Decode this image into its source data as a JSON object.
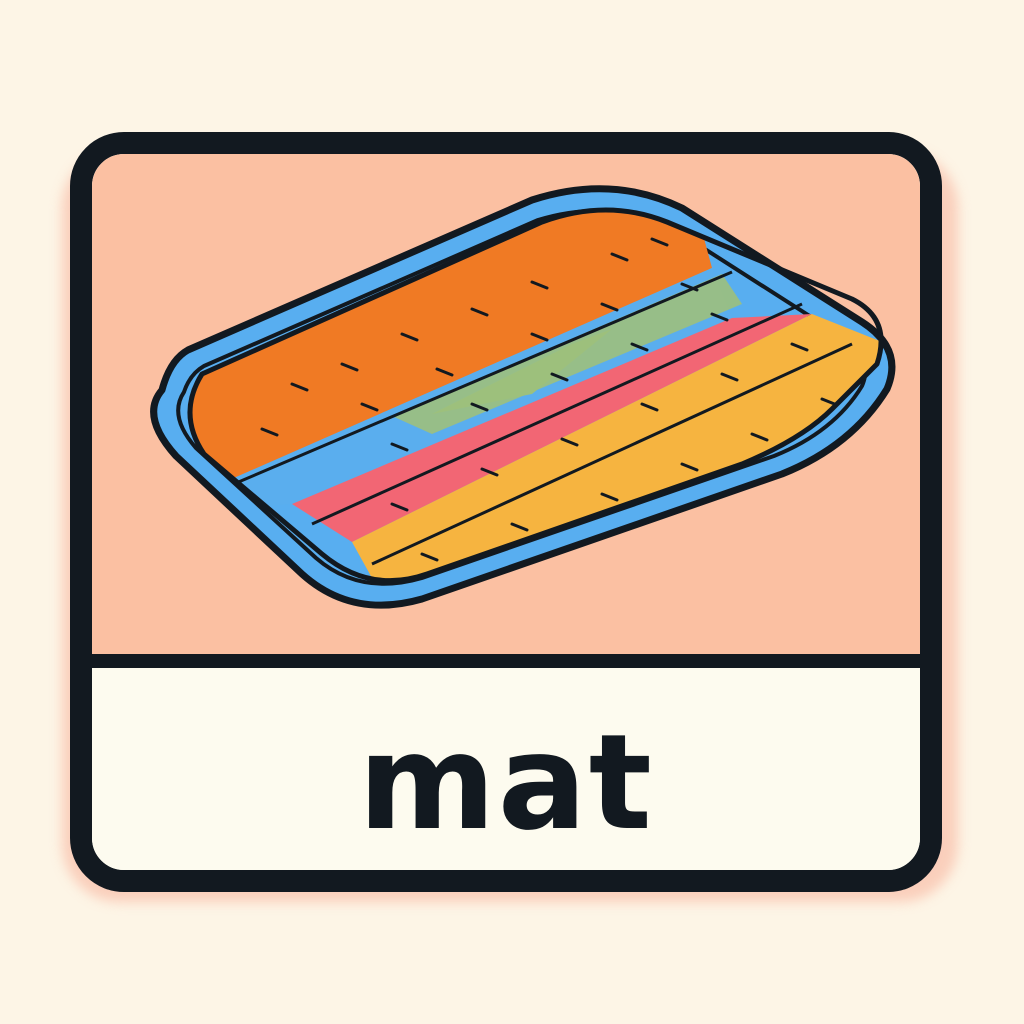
{
  "flashcard": {
    "word": "mat",
    "picture_icon": "striped-mat-icon"
  },
  "colors": {
    "background": "#fdf5e6",
    "card_border": "#121920",
    "picture_background": "#fbc0a2",
    "label_background": "#fdfbef",
    "mat_frame": "#58aef0",
    "stripe_orange": "#f07a24",
    "stripe_blue": "#5aaeee",
    "stripe_green": "#9dc07c",
    "stripe_pink": "#f26674",
    "stripe_yellow": "#f6b440"
  }
}
